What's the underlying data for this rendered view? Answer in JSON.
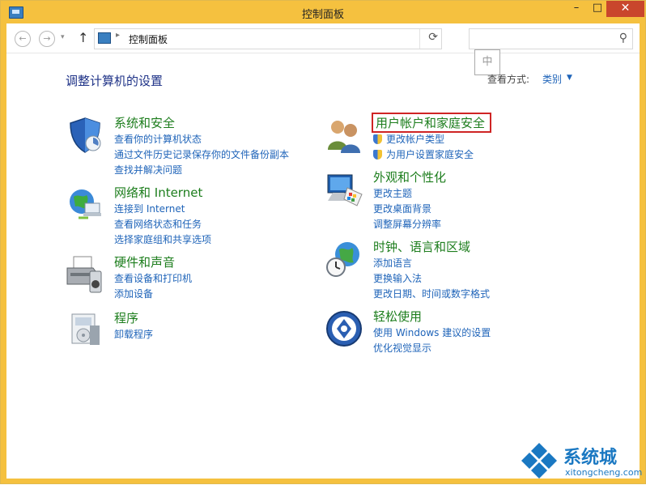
{
  "window": {
    "title": "控制面板",
    "minimize": "–",
    "maximize": "□",
    "close": "✕"
  },
  "address": {
    "path": "控制面板",
    "search_placeholder": ""
  },
  "ime": "中",
  "main": {
    "heading": "调整计算机的设置",
    "view_by_label": "查看方式:",
    "view_by_value": "类别"
  },
  "categories": [
    {
      "icon": "shield-icon",
      "title": "系统和安全",
      "links": [
        "查看你的计算机状态",
        "通过文件历史记录保存你的文件备份副本",
        "查找并解决问题"
      ]
    },
    {
      "icon": "network-globe-icon",
      "title": "网络和 Internet",
      "links": [
        "连接到 Internet",
        "查看网络状态和任务",
        "选择家庭组和共享选项"
      ]
    },
    {
      "icon": "printer-icon",
      "title": "硬件和声音",
      "links": [
        "查看设备和打印机",
        "添加设备"
      ]
    },
    {
      "icon": "programs-icon",
      "title": "程序",
      "links": [
        "卸载程序"
      ]
    },
    {
      "icon": "users-icon",
      "title": "用户帐户和家庭安全",
      "links": [
        "更改帐户类型",
        "为用户设置家庭安全"
      ]
    },
    {
      "icon": "display-palette-icon",
      "title": "外观和个性化",
      "links": [
        "更改主题",
        "更改桌面背景",
        "调整屏幕分辨率"
      ]
    },
    {
      "icon": "clock-globe-icon",
      "title": "时钟、语言和区域",
      "links": [
        "添加语言",
        "更换输入法",
        "更改日期、时间或数字格式"
      ]
    },
    {
      "icon": "ease-of-access-icon",
      "title": "轻松使用",
      "links": [
        "使用 Windows 建议的设置",
        "优化视觉显示"
      ]
    }
  ],
  "watermark": {
    "cn": "系统城",
    "en": "xitongcheng.com"
  }
}
